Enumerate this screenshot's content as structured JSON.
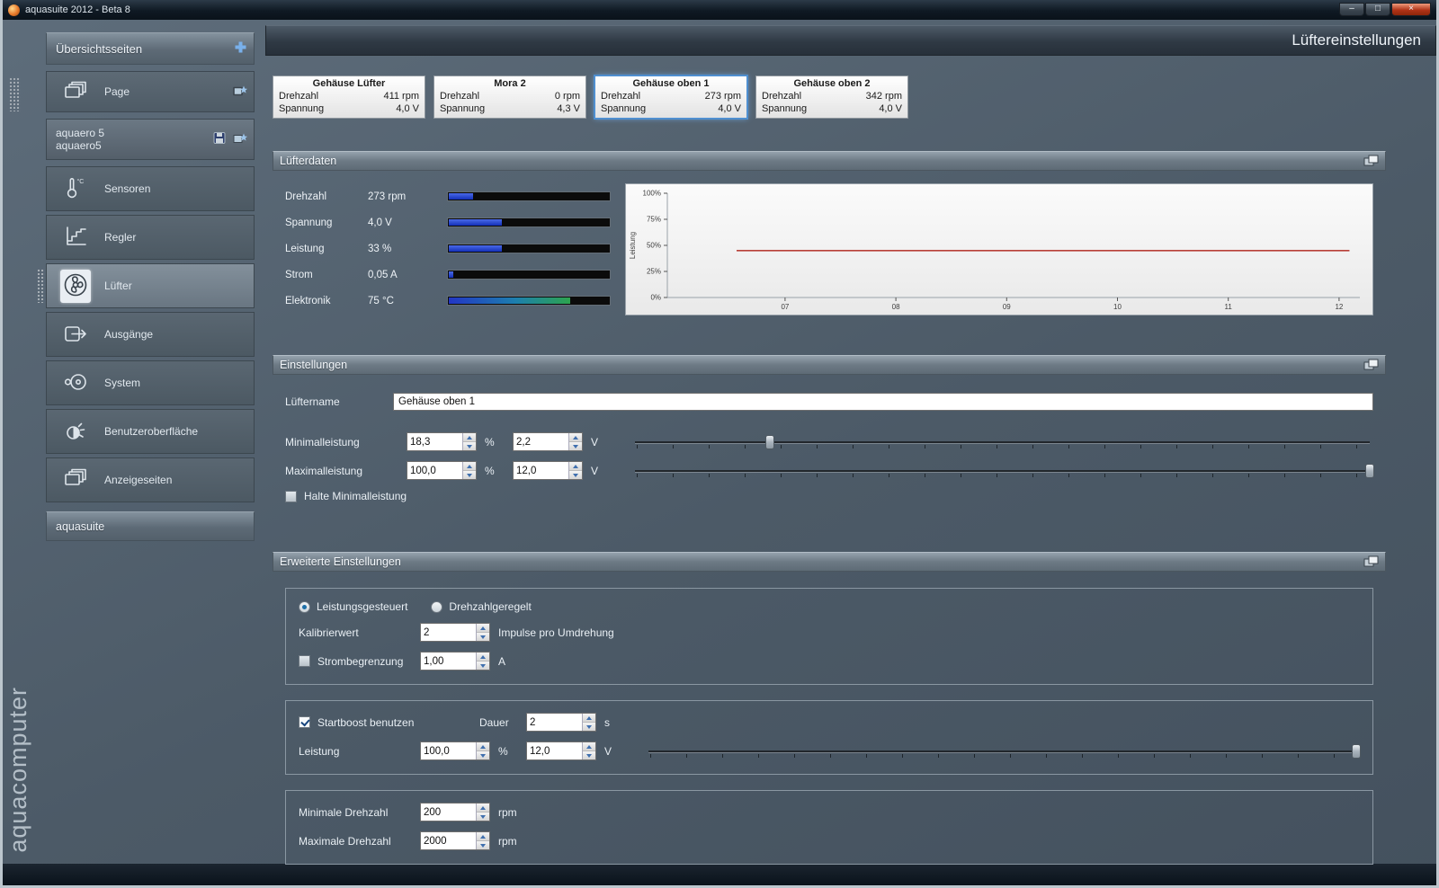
{
  "window": {
    "title": "aquasuite 2012 - Beta 8"
  },
  "icons": {
    "minimize": "–",
    "maximize": "□",
    "close": "×"
  },
  "sidebar": {
    "logo": "aquacomputer",
    "overview_header": "Übersichtsseiten",
    "page_label": "Page",
    "device_line1": "aquaero 5",
    "device_line2": "aquaero5",
    "sensor_icon_label": "°C",
    "items": [
      {
        "label": "Sensoren"
      },
      {
        "label": "Regler"
      },
      {
        "label": "Lüfter",
        "selected": true
      },
      {
        "label": "Ausgänge"
      },
      {
        "label": "System"
      },
      {
        "label": "Benutzeroberfläche"
      },
      {
        "label": "Anzeigeseiten"
      }
    ],
    "aquasuite_header": "aquasuite"
  },
  "header": {
    "title": "Lüftereinstellungen"
  },
  "fan_cards": [
    {
      "name": "Gehäuse Lüfter",
      "rpm_label": "Drehzahl",
      "rpm_value": "411 rpm",
      "volt_label": "Spannung",
      "volt_value": "4,0 V",
      "selected": false
    },
    {
      "name": "Mora 2",
      "rpm_label": "Drehzahl",
      "rpm_value": "0 rpm",
      "volt_label": "Spannung",
      "volt_value": "4,3 V",
      "selected": false
    },
    {
      "name": "Gehäuse oben 1",
      "rpm_label": "Drehzahl",
      "rpm_value": "273 rpm",
      "volt_label": "Spannung",
      "volt_value": "4,0 V",
      "selected": true
    },
    {
      "name": "Gehäuse oben 2",
      "rpm_label": "Drehzahl",
      "rpm_value": "342 rpm",
      "volt_label": "Spannung",
      "volt_value": "4,0 V",
      "selected": false
    }
  ],
  "luefterdaten": {
    "title": "Lüfterdaten",
    "rows": [
      {
        "label": "Drehzahl",
        "value": "273 rpm",
        "fill": 15,
        "temp": false
      },
      {
        "label": "Spannung",
        "value": "4,0 V",
        "fill": 33,
        "temp": false
      },
      {
        "label": "Leistung",
        "value": "33 %",
        "fill": 33,
        "temp": false
      },
      {
        "label": "Strom",
        "value": "0,05 A",
        "fill": 3,
        "temp": false
      },
      {
        "label": "Elektronik",
        "value": "75 °C",
        "fill": 75,
        "temp": true
      }
    ],
    "chart_data": {
      "type": "line",
      "ylabel": "Leistung",
      "ylim": [
        0,
        100
      ],
      "yticks": [
        100,
        75,
        50,
        25,
        0
      ],
      "ytick_labels": [
        "100%",
        "75%",
        "50%",
        "25%",
        "0%"
      ],
      "xtick_labels": [
        "07",
        "08",
        "09",
        "10",
        "11",
        "12"
      ],
      "grid": false,
      "legend": "none",
      "series": [
        {
          "name": "Leistung",
          "color": "#b84038",
          "value": 45,
          "x_start": 0.1,
          "x_end": 0.985
        }
      ]
    }
  },
  "einstellungen": {
    "title": "Einstellungen",
    "fan_name_label": "Lüftername",
    "fan_name_value": "Gehäuse oben 1",
    "pct_unit": "%",
    "volt_unit": "V",
    "rows": [
      {
        "label": "Minimalleistung",
        "pct": "18,3",
        "volt": "2,2",
        "slider_pos": 18.3
      },
      {
        "label": "Maximalleistung",
        "pct": "100,0",
        "volt": "12,0",
        "slider_pos": 100
      }
    ],
    "hold_min_label": "Halte Minimalleistung",
    "hold_min_checked": false
  },
  "erweitert": {
    "title": "Erweiterte Einstellungen",
    "mode_power_label": "Leistungsgesteuert",
    "mode_power_selected": true,
    "mode_rpm_label": "Drehzahlgeregelt",
    "mode_rpm_selected": false,
    "kalibrierwert_label": "Kalibrierwert",
    "kalibrierwert_value": "2",
    "kalibrierwert_unit": "Impulse pro Umdrehung",
    "strombegrenzung_label": "Strombegrenzung",
    "strombegrenzung_checked": false,
    "strombegrenzung_value": "1,00",
    "strombegrenzung_unit": "A",
    "startboost_label": "Startboost benutzen",
    "startboost_checked": true,
    "dauer_label": "Dauer",
    "dauer_value": "2",
    "dauer_unit": "s",
    "leistung_label": "Leistung",
    "leistung_pct": "100,0",
    "leistung_volt": "12,0",
    "leistung_slider_pos": 100,
    "pct_unit": "%",
    "volt_unit": "V",
    "min_rpm_label": "Minimale Drehzahl",
    "min_rpm_value": "200",
    "max_rpm_label": "Maximale Drehzahl",
    "max_rpm_value": "2000",
    "rpm_unit": "rpm"
  }
}
